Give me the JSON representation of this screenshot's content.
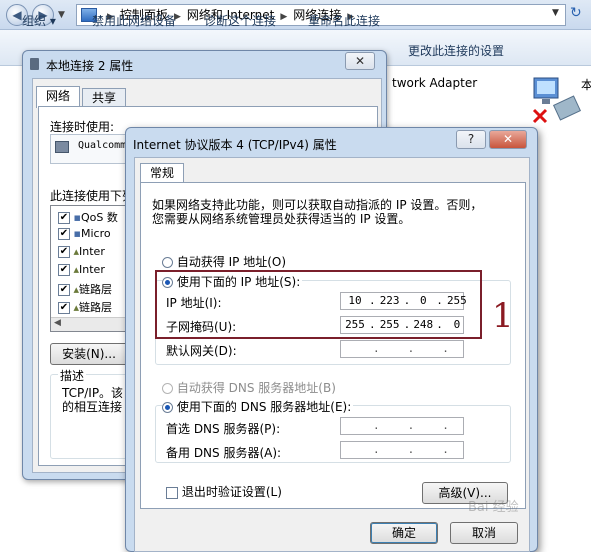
{
  "address_bar": {
    "crumbs": [
      "控制面板",
      "网络和 Internet",
      "网络连接"
    ]
  },
  "command_bar": {
    "items": [
      "组织 ▾",
      "禁用此网络设备",
      "诊断这个连接",
      "重命名此连接",
      "更改此连接的设置"
    ]
  },
  "background": {
    "adapter_text": "twork Adapter",
    "side_text": "本"
  },
  "win1": {
    "title": "本地连接 2 属性",
    "close": "✕",
    "tabs": [
      "网络",
      "共享"
    ],
    "connect_using_label": "连接时使用:",
    "adapter_name": "Qualcomm",
    "items_label": "此连接使用下列项目(O):",
    "items": [
      "QoS 数",
      "Micro",
      "Inter",
      "Inter",
      "链路层",
      "链路层"
    ],
    "install_button": "安装(N)...",
    "description_label": "描述",
    "description_text": [
      "TCP/IP。该",
      "的相互连接"
    ]
  },
  "win2": {
    "title": "Internet 协议版本 4 (TCP/IPv4) 属性",
    "help": "?",
    "close": "✕",
    "tab": "常规",
    "intro": [
      "如果网络支持此功能，则可以获取自动指派的 IP 设置。否则，",
      "您需要从网络系统管理员处获得适当的 IP 设置。"
    ],
    "auto_ip": "自动获得 IP 地址(O)",
    "manual_ip": "使用下面的 IP 地址(S):",
    "ip_label": "IP 地址(I):",
    "ip_value": [
      "10",
      "223",
      "0",
      "255"
    ],
    "mask_label": "子网掩码(U):",
    "mask_value": [
      "255",
      "255",
      "248",
      "0"
    ],
    "gateway_label": "默认网关(D):",
    "auto_dns": "自动获得 DNS 服务器地址(B)",
    "manual_dns": "使用下面的 DNS 服务器地址(E):",
    "dns1_label": "首选 DNS 服务器(P):",
    "dns2_label": "备用 DNS 服务器(A):",
    "validate": "退出时验证设置(L)",
    "advanced": "高级(V)...",
    "ok": "确定",
    "cancel": "取消"
  },
  "annotation": "1",
  "watermark": "Bai 经验"
}
